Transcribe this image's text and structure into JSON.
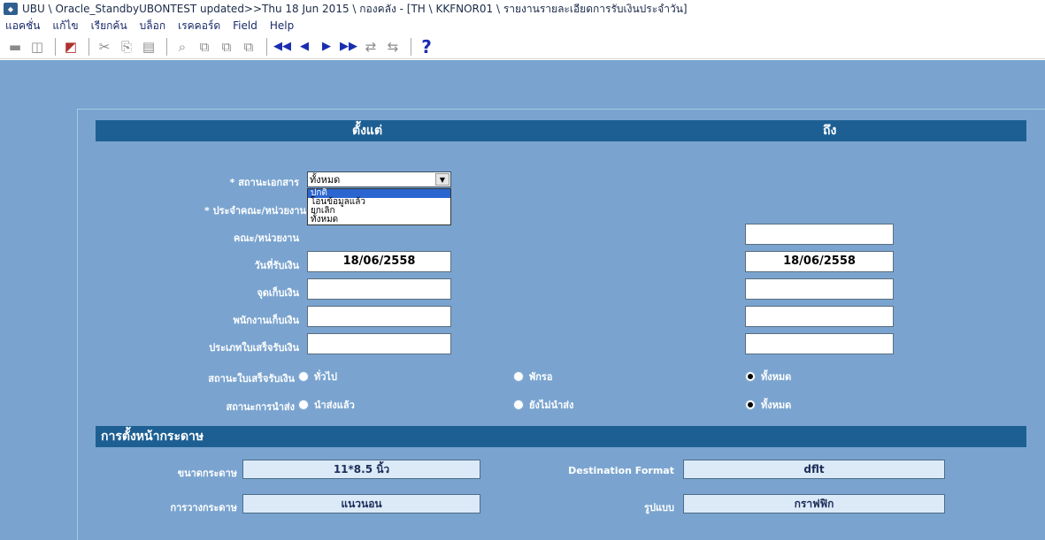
{
  "window": {
    "title": "UBU \\ Oracle_StandbyUBONTEST updated>>Thu 18 Jun 2015 \\ กองคลัง - [TH \\ KKFNOR01 \\ รายงานรายละเอียดการรับเงินประจำวัน]"
  },
  "menu": [
    "แอคชั่น",
    "แก้ไข",
    "เรียกค้น",
    "บล็อก",
    "เรคคอร์ด",
    "Field",
    "Help"
  ],
  "form": {
    "header_from": "ตั้งแต่",
    "header_to": "ถึง",
    "status_label": "* สถานะเอกสาร",
    "status_value": "ทั้งหมด",
    "status_options": [
      "ปกติ",
      "โอนข้อมูลแล้ว",
      "ยกเลิก",
      "ทั้งหมด"
    ],
    "faculty_owner_label": "* ประจำคณะ/หน่วยงาน",
    "faculty_label": "คณะ/หน่วยงาน",
    "faculty_to": "",
    "receipt_date_label": "วันที่รับเงิน",
    "receipt_date_from": "18/06/2558",
    "receipt_date_to": "18/06/2558",
    "collect_point_label": "จุดเก็บเงิน",
    "collect_point_from": "",
    "collect_point_to": "",
    "collector_label": "พนักงานเก็บเงิน",
    "collector_from": "",
    "collector_to": "",
    "receipt_type_label": "ประเภทใบเสร็จรับเงิน",
    "receipt_type_from": "",
    "receipt_type_to": "",
    "receipt_status_label": "สถานะใบเสร็จรับเงิน",
    "receipt_status_options": [
      "ทั่วไป",
      "พักรอ",
      "ทั้งหมด"
    ],
    "receipt_status_selected": "ทั้งหมด",
    "send_status_label": "สถานะการนำส่ง",
    "send_status_options": [
      "นำส่งแล้ว",
      "ยังไม่นำส่ง",
      "ทั้งหมด"
    ],
    "send_status_selected": "ทั้งหมด"
  },
  "page_setup": {
    "header": "การตั้งหน้ากระดาษ",
    "paper_size_label": "ขนาดกระดาษ",
    "paper_size_value": "11*8.5 นิ้ว",
    "destination_format_label": "Destination Format",
    "destination_format_value": "dflt",
    "orientation_label": "การวางกระดาษ",
    "orientation_value": "แนวนอน",
    "style_label": "รูปแบบ",
    "style_value": "กราฟฟิก"
  },
  "colors": {
    "background": "#7aa4cf",
    "band": "#1d5f93",
    "selection": "#2b66d0"
  }
}
